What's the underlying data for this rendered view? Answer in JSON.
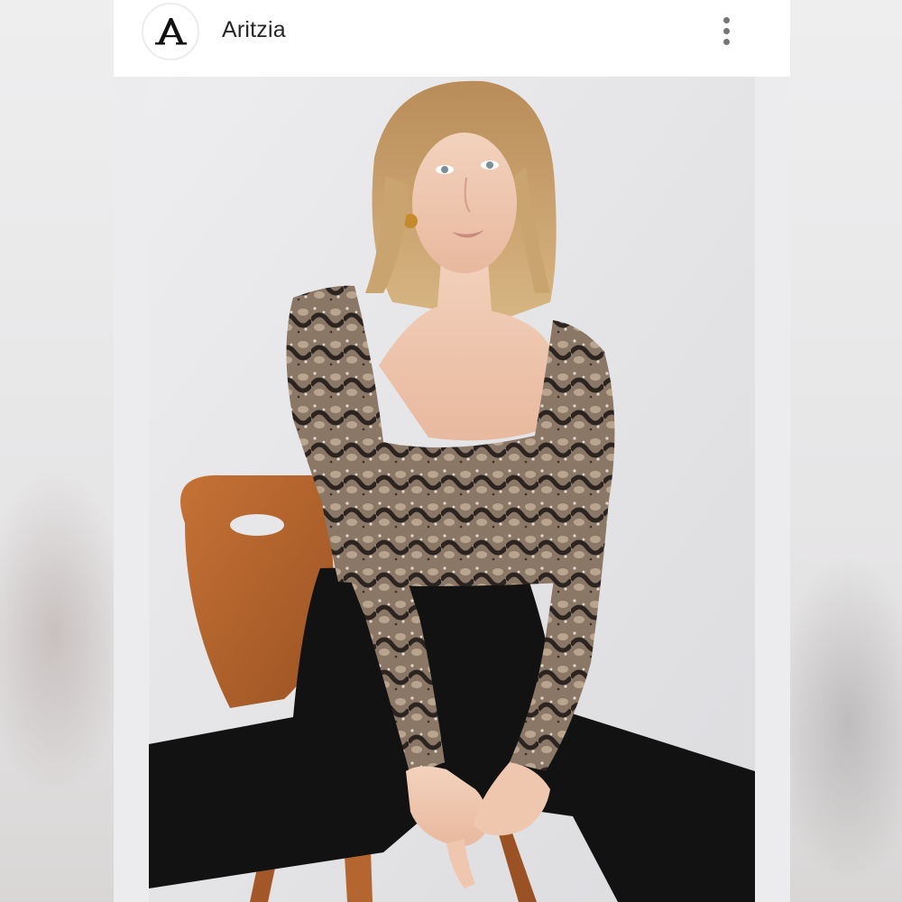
{
  "post": {
    "account_name": "Aritzia",
    "avatar_icon": "aritzia-logo-icon",
    "avatar_letter": "A",
    "menu_icon": "more-vertical-icon",
    "photo_icon": "product-photo"
  },
  "colors": {
    "header_bg": "#ffffff",
    "name_text": "#262626",
    "menu_dots": "#767676",
    "photo_bg": "#e7e7e9",
    "chair_wood": "#b5652d",
    "pants": "#111111",
    "top_print": "#7a6a5c"
  }
}
